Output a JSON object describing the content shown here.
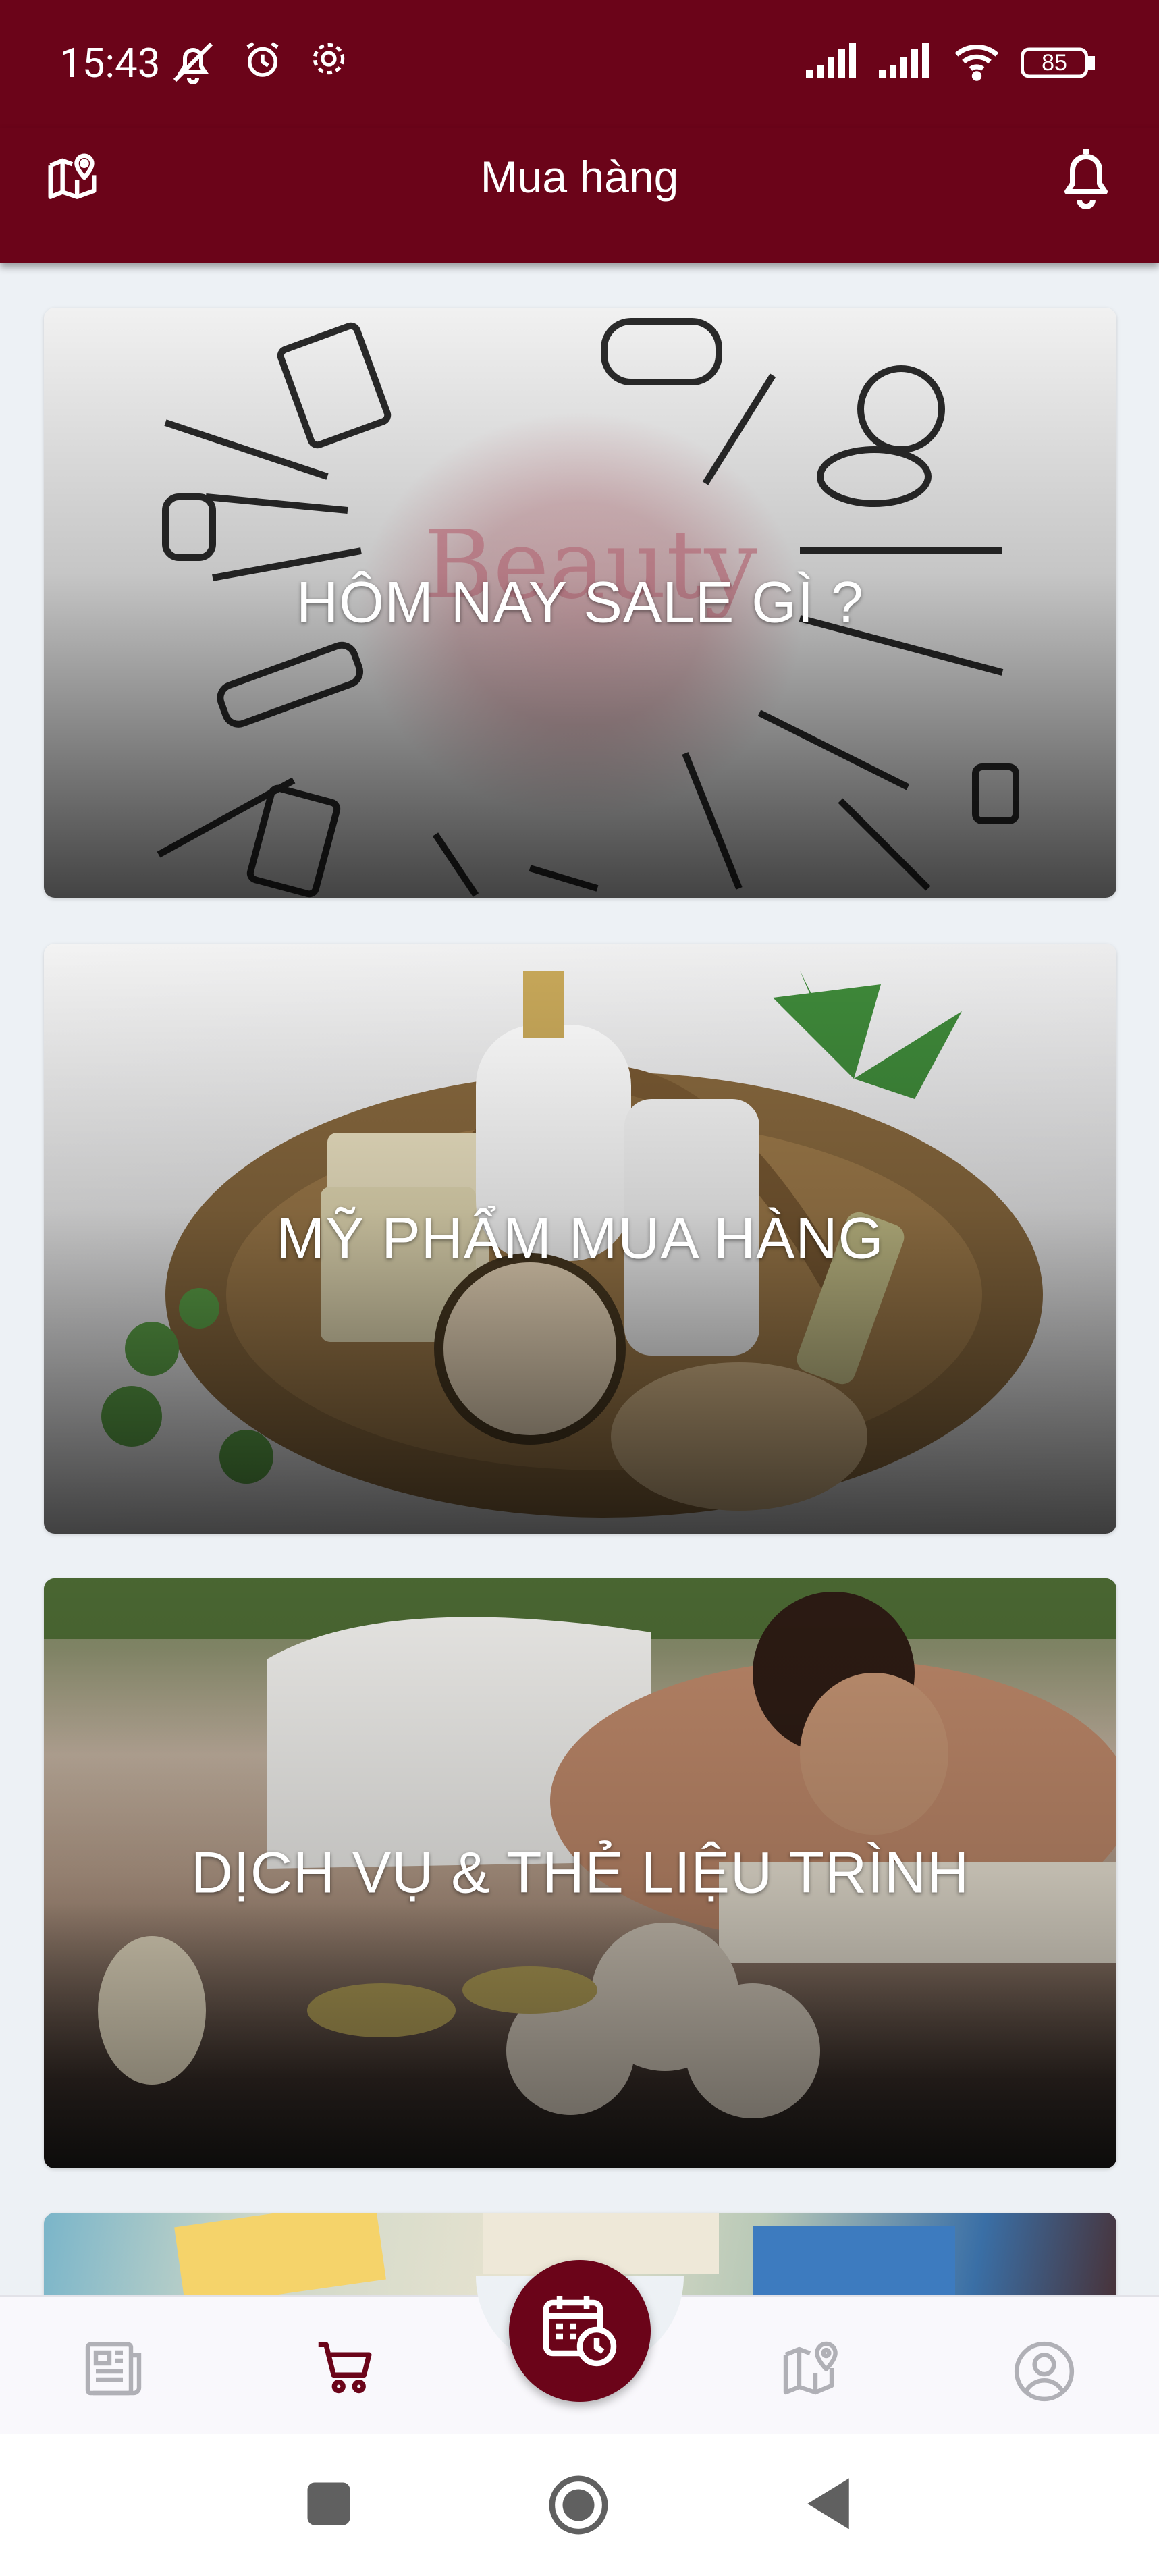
{
  "status_bar": {
    "time": "15:43",
    "battery": "85",
    "icons": [
      "mute-icon",
      "alarm-icon",
      "settings-icon",
      "signal-icon",
      "signal-icon-2",
      "wifi-icon",
      "battery-icon"
    ]
  },
  "app_bar": {
    "title": "Mua hàng",
    "left_icon": "map-pin-icon",
    "right_icon": "bell-icon"
  },
  "cards": [
    {
      "label": "HÔM NAY SALE GÌ ?"
    },
    {
      "label": "MỸ PHẨM MUA HÀNG"
    },
    {
      "label": "DỊCH VỤ & THẺ LIỆU TRÌNH"
    }
  ],
  "bottom_nav": {
    "items": [
      "news-icon",
      "cart-icon",
      "calendar-clock-icon",
      "map-icon",
      "profile-icon"
    ],
    "active": "cart-icon",
    "accent": "#6b0419",
    "inactive": "#b0b0b6"
  },
  "colors": {
    "brand": "#6b0419",
    "background": "#edf1f5"
  }
}
